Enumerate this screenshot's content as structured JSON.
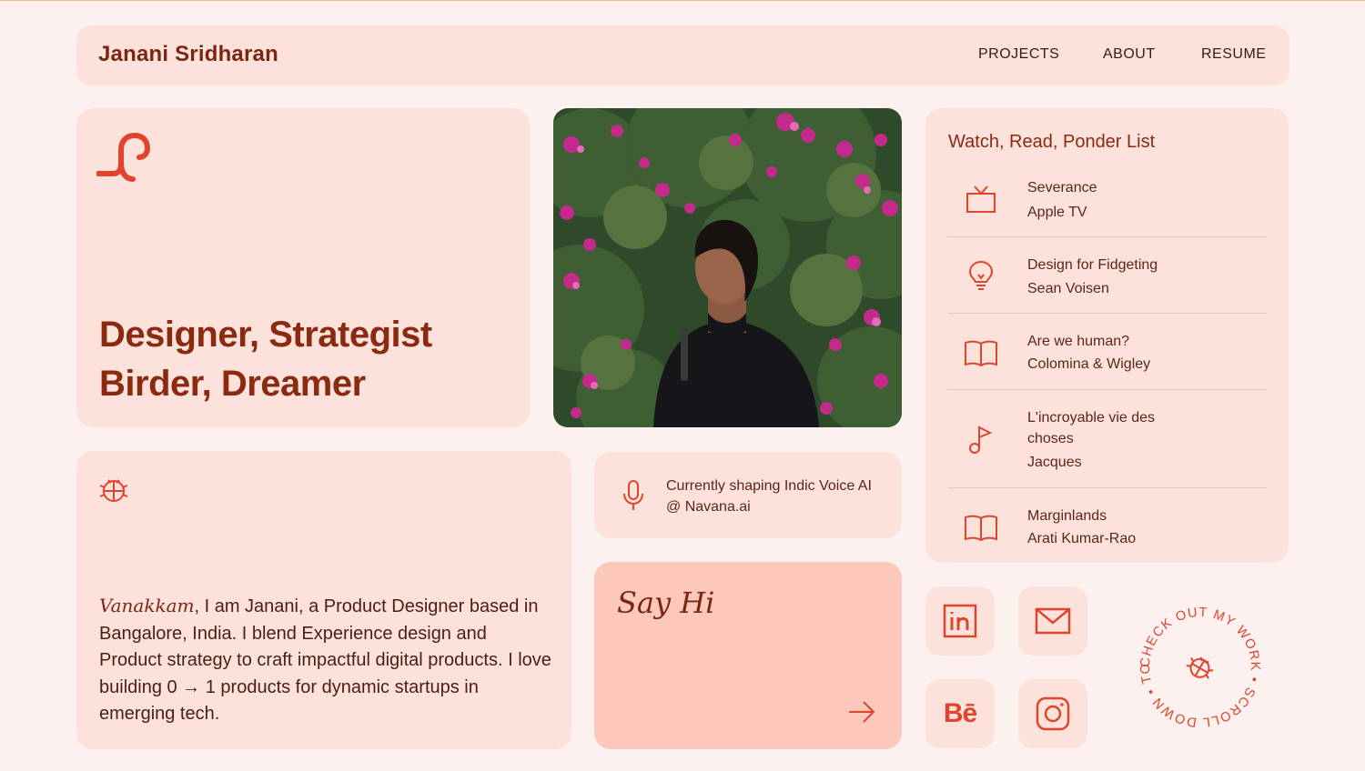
{
  "header": {
    "site_name": "Janani Sridharan",
    "nav": [
      {
        "label": "PROJECTS"
      },
      {
        "label": "ABOUT"
      },
      {
        "label": "RESUME"
      }
    ]
  },
  "hero": {
    "logo_icon": "swirl-logo-icon",
    "tagline_line1": "Designer, Strategist",
    "tagline_line2": "Birder, Dreamer"
  },
  "photo": {
    "icon": "portrait-photo"
  },
  "reading_list": {
    "title": "Watch, Read, Ponder List",
    "items": [
      {
        "icon": "tv-icon",
        "title": "Severance",
        "subtitle": "Apple TV"
      },
      {
        "icon": "lightbulb-icon",
        "title": "Design for Fidgeting",
        "subtitle": "Sean Voisen"
      },
      {
        "icon": "book-icon",
        "title": "Are we human?",
        "subtitle": "Colomina & Wigley"
      },
      {
        "icon": "music-note-icon",
        "title": "L'incroyable vie des choses",
        "subtitle": "Jacques"
      },
      {
        "icon": "book-icon",
        "title": "Marginlands",
        "subtitle": "Arati Kumar-Rao"
      }
    ]
  },
  "bio": {
    "icon": "bug-icon",
    "lead": "Vanakkam",
    "text": ", I am Janani, a Product Designer based in Bangalore, India. I blend Experience design and Product strategy to craft impactful digital products. I love building 0 → 1 products for dynamic startups in emerging tech."
  },
  "current": {
    "icon": "microphone-icon",
    "text": "Currently shaping Indic Voice AI @ Navana.ai"
  },
  "say_hi": {
    "label": "Say Hi",
    "icon": "arrow-right-icon"
  },
  "social": {
    "linkedin_icon": "linkedin-icon",
    "email_icon": "mail-icon",
    "behance_label": "Bē",
    "instagram_icon": "instagram-icon"
  },
  "scroll_badge": {
    "text": "CHECK OUT MY WORK • SCROLL DOWN • TO ",
    "icon": "bug-icon"
  },
  "colors": {
    "background": "#fdf1ef",
    "card": "#fde2dc",
    "accent": "#e0452c",
    "heading": "#8a2a10",
    "say_hi_card": "#fbc8bb"
  }
}
